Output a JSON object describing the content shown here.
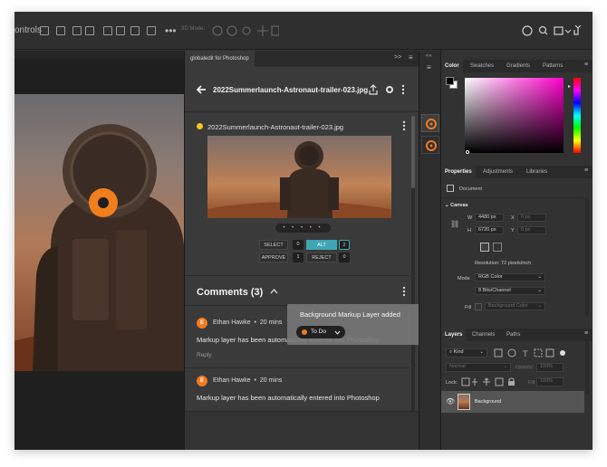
{
  "options_bar": {
    "label": "ontrols",
    "mode_3d": "3D Mode:"
  },
  "canvas": {},
  "plugin": {
    "tab": "globaledit for Photoshop",
    "file_title": "2022Summerlaunch-Astronaut-trailer-023.jpg",
    "card_file_name": "2022Summerlaunch-Astronaut-trailer-023.jpg",
    "image_dots": "• • • • •",
    "votes": {
      "select_label": "SELECT",
      "select_count": "0",
      "alt_label": "ALT",
      "alt_count": "2",
      "approve_label": "APPROVE",
      "approve_count": "1",
      "reject_label": "REJECT",
      "reject_count": "0"
    },
    "comments_title": "Comments (3)",
    "comments": [
      {
        "initial": "E",
        "author": "Ethan Hawke",
        "time": "20 mins",
        "text": "Markup layer has been automatically entered into Photoshop",
        "reply": "Reply"
      },
      {
        "initial": "E",
        "author": "Ethan Hawke",
        "time": "20 mins",
        "text": "Markup layer has been automatically entered into Photoshop"
      }
    ]
  },
  "toast": {
    "title": "Background Markup Layer added",
    "status": "To Do"
  },
  "color_panel": {
    "tabs": [
      "Color",
      "Swatches",
      "Gradients",
      "Patterns"
    ],
    "accent_hue": "#ff00cc"
  },
  "properties_panel": {
    "tabs": [
      "Properties",
      "Adjustments",
      "Libraries"
    ],
    "doc_label": "Document",
    "section": "Canvas",
    "w_label": "W",
    "w_value": "4480 px",
    "h_label": "H",
    "h_value": "6720 px",
    "x_label": "X",
    "x_value": "0 px",
    "y_label": "Y",
    "y_value": "0 px",
    "resolution": "Resolution: 72 pixels/inch",
    "mode_label": "Mode",
    "mode_value": "RGB Color",
    "bits_value": "8 Bits/Channel",
    "fill_label": "Fill",
    "fill_value": "Background Color"
  },
  "layers_panel": {
    "tabs": [
      "Layers",
      "Channels",
      "Paths"
    ],
    "kind_placeholder": "Kind",
    "blend_mode": "Normal",
    "opacity_label": "Opacity:",
    "opacity_value": "100%",
    "lock_label": "Lock:",
    "fill_label": "Fill:",
    "fill_value": "100%",
    "layer_name": "Background"
  }
}
